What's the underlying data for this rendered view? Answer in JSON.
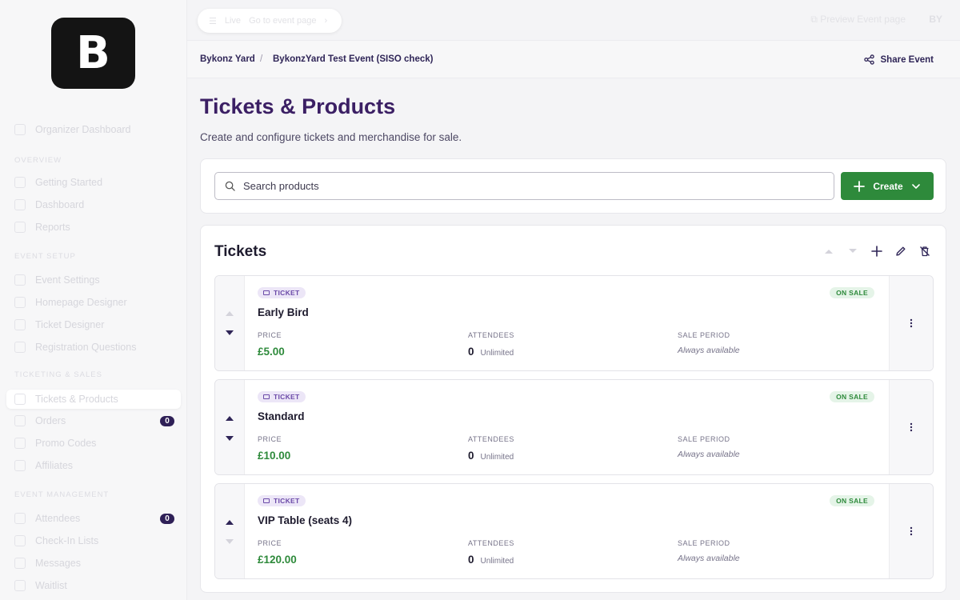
{
  "brand": {
    "logo_letter": "B"
  },
  "sidebar": {
    "top_item": "Organizer Dashboard",
    "sections": [
      {
        "title": "OVERVIEW",
        "items": [
          {
            "label": "Getting Started"
          },
          {
            "label": "Dashboard"
          },
          {
            "label": "Reports"
          }
        ]
      },
      {
        "title": "EVENT SETUP",
        "items": [
          {
            "label": "Event Settings"
          },
          {
            "label": "Homepage Designer"
          },
          {
            "label": "Ticket Designer"
          },
          {
            "label": "Registration Questions"
          }
        ]
      },
      {
        "title": "TICKETING & SALES",
        "items": [
          {
            "label": "Tickets & Products"
          },
          {
            "label": "Orders",
            "badge": "0"
          },
          {
            "label": "Promo Codes"
          },
          {
            "label": "Affiliates"
          }
        ]
      },
      {
        "title": "EVENT MANAGEMENT",
        "items": [
          {
            "label": "Attendees",
            "badge": "0"
          },
          {
            "label": "Check-In Lists"
          },
          {
            "label": "Messages"
          },
          {
            "label": "Waitlist"
          }
        ]
      }
    ]
  },
  "topbar": {
    "env_label": "Live",
    "env_sub": "Go to event page",
    "preview_label": "Preview Event page",
    "avatar_initials": "BY"
  },
  "breadcrumb": {
    "org": "Bykonz Yard",
    "separator": "/",
    "event": "BykonzYard Test Event (SISO check)",
    "share_label": "Share Event"
  },
  "page": {
    "title": "Tickets & Products",
    "subtitle": "Create and configure tickets and merchandise for sale."
  },
  "search": {
    "placeholder": "Search products",
    "value": ""
  },
  "create_button": {
    "label": "Create"
  },
  "tickets_section": {
    "title": "Tickets",
    "labels": {
      "price": "PRICE",
      "attendees": "ATTENDEES",
      "sale_period": "SALE PERIOD"
    },
    "items": [
      {
        "type_tag": "TICKET",
        "status": "ON SALE",
        "name": "Early Bird",
        "price": "£5.00",
        "attendees": "0",
        "attendees_limit": "Unlimited",
        "sale_period": "Always available"
      },
      {
        "type_tag": "TICKET",
        "status": "ON SALE",
        "name": "Standard",
        "price": "£10.00",
        "attendees": "0",
        "attendees_limit": "Unlimited",
        "sale_period": "Always available"
      },
      {
        "type_tag": "TICKET",
        "status": "ON SALE",
        "name": "VIP Table (seats 4)",
        "price": "£120.00",
        "attendees": "0",
        "attendees_limit": "Unlimited",
        "sale_period": "Always available"
      }
    ]
  },
  "colors": {
    "accent_purple": "#3b1f64",
    "primary_green": "#2e8a3b",
    "badge_dark": "#2f2057"
  }
}
